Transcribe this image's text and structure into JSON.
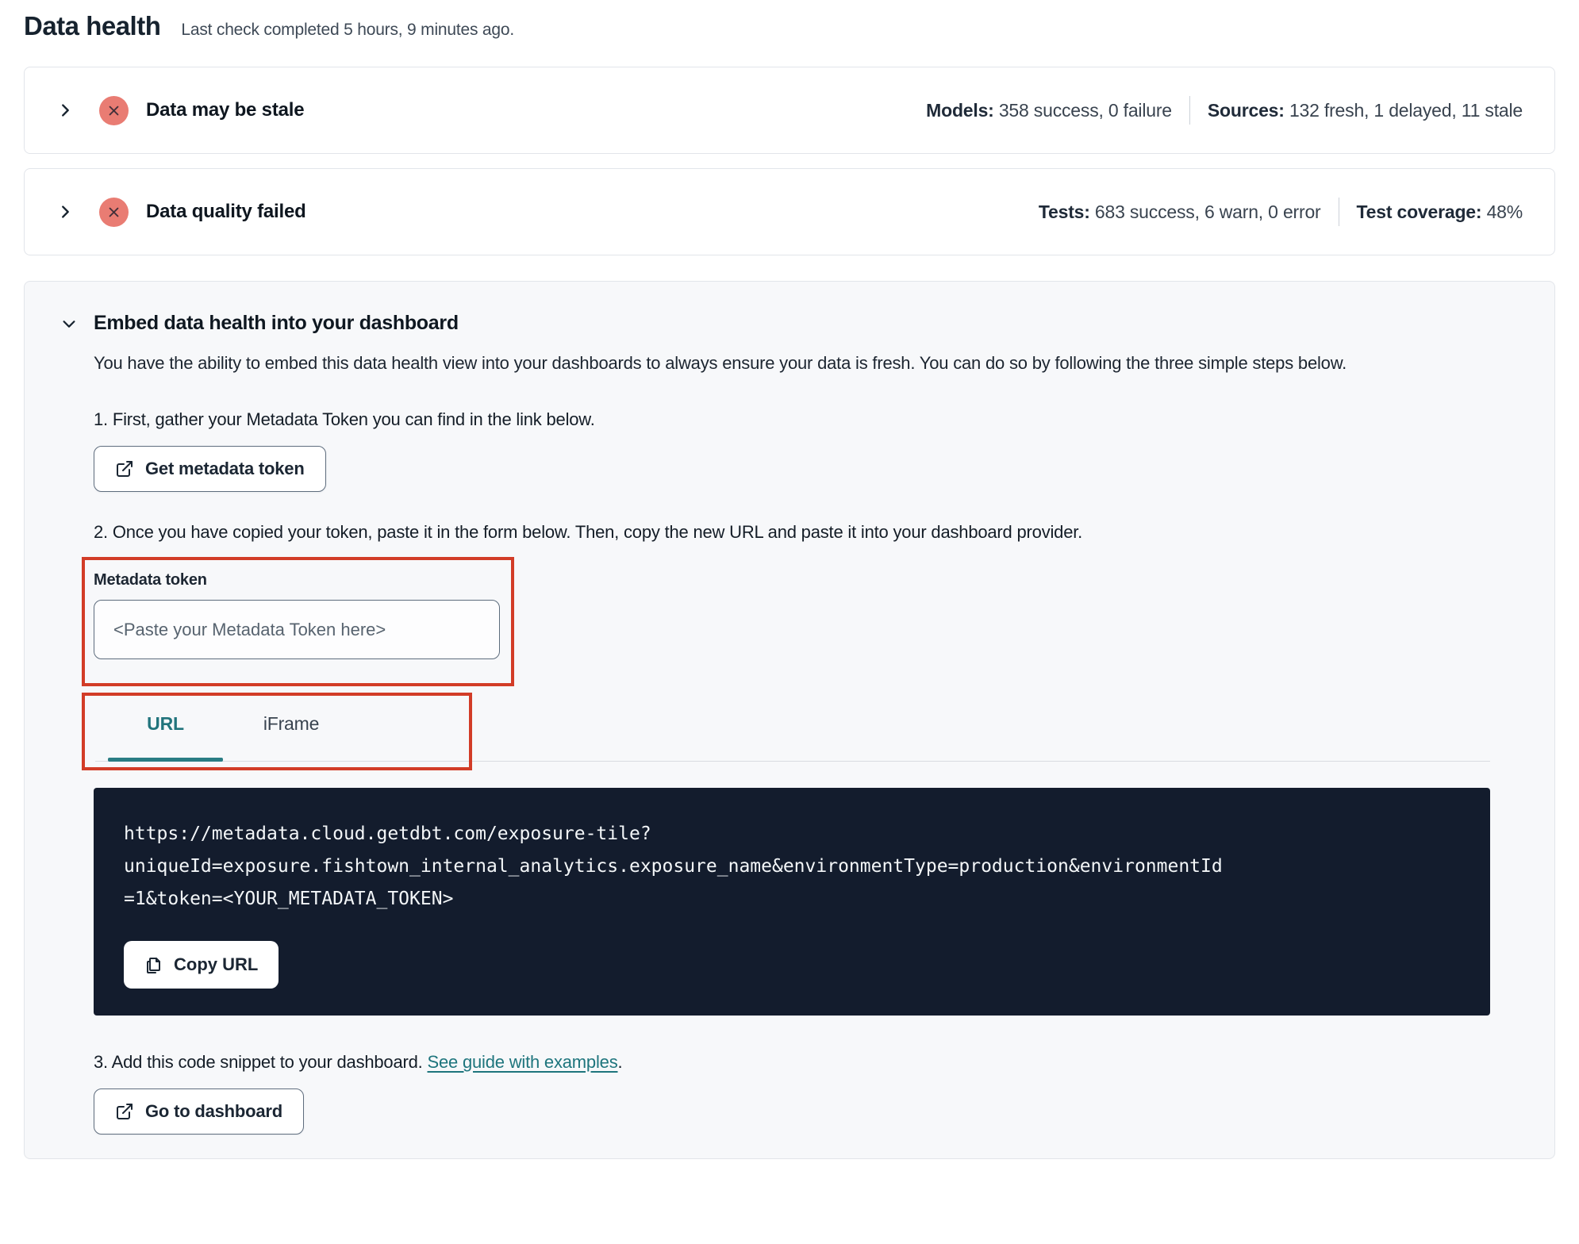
{
  "page": {
    "title": "Data health",
    "subtitle": "Last check completed 5 hours, 9 minutes ago."
  },
  "accordions": [
    {
      "title": "Data may be stale",
      "status_icon": "error-x-icon",
      "stats": [
        {
          "label": "Models:",
          "value": "358 success, 0 failure"
        },
        {
          "label": "Sources:",
          "value": "132 fresh, 1 delayed, 11 stale"
        }
      ]
    },
    {
      "title": "Data quality failed",
      "status_icon": "error-x-icon",
      "stats": [
        {
          "label": "Tests:",
          "value": "683 success, 6 warn, 0 error"
        },
        {
          "label": "Test coverage:",
          "value": "48%"
        }
      ]
    }
  ],
  "embed": {
    "title": "Embed data health into your dashboard",
    "description": "You have the ability to embed this data health view into your dashboards to always ensure your data is fresh. You can do so by following the three simple steps below.",
    "step1": {
      "text": "1. First, gather your Metadata Token you can find in the link below.",
      "button_label": "Get metadata token",
      "button_icon": "external-link-icon"
    },
    "step2": {
      "text": "2. Once you have copied your token, paste it in the form below. Then, copy the new URL and paste it into your dashboard provider.",
      "token_label": "Metadata token",
      "token_placeholder": "<Paste your Metadata Token here>",
      "tabs": [
        {
          "label": "URL",
          "active": true
        },
        {
          "label": "iFrame",
          "active": false
        }
      ],
      "code_lines": [
        "https://metadata.cloud.getdbt.com/exposure-tile?",
        "uniqueId=exposure.fishtown_internal_analytics.exposure_name&environmentType=production&environmentId",
        "=1&token=<YOUR_METADATA_TOKEN>"
      ],
      "code_url_full": "https://metadata.cloud.getdbt.com/exposure-tile?uniqueId=exposure.fishtown_internal_analytics.exposure_name&environmentType=production&environmentId=1&token=<YOUR_METADATA_TOKEN>",
      "copy_button_label": "Copy URL",
      "copy_button_icon": "copy-icon"
    },
    "step3": {
      "text_before_link": "3. Add this code snippet to your dashboard. ",
      "link_label": "See guide with examples",
      "text_after_link": ".",
      "button_label": "Go to dashboard",
      "button_icon": "external-link-icon"
    }
  },
  "colors": {
    "status_error_bg": "#e97c73",
    "annotation_red": "#d23c27",
    "accent_teal": "#21747c",
    "code_block_bg": "#131c2d",
    "panel_bg": "#f7f8fa"
  }
}
